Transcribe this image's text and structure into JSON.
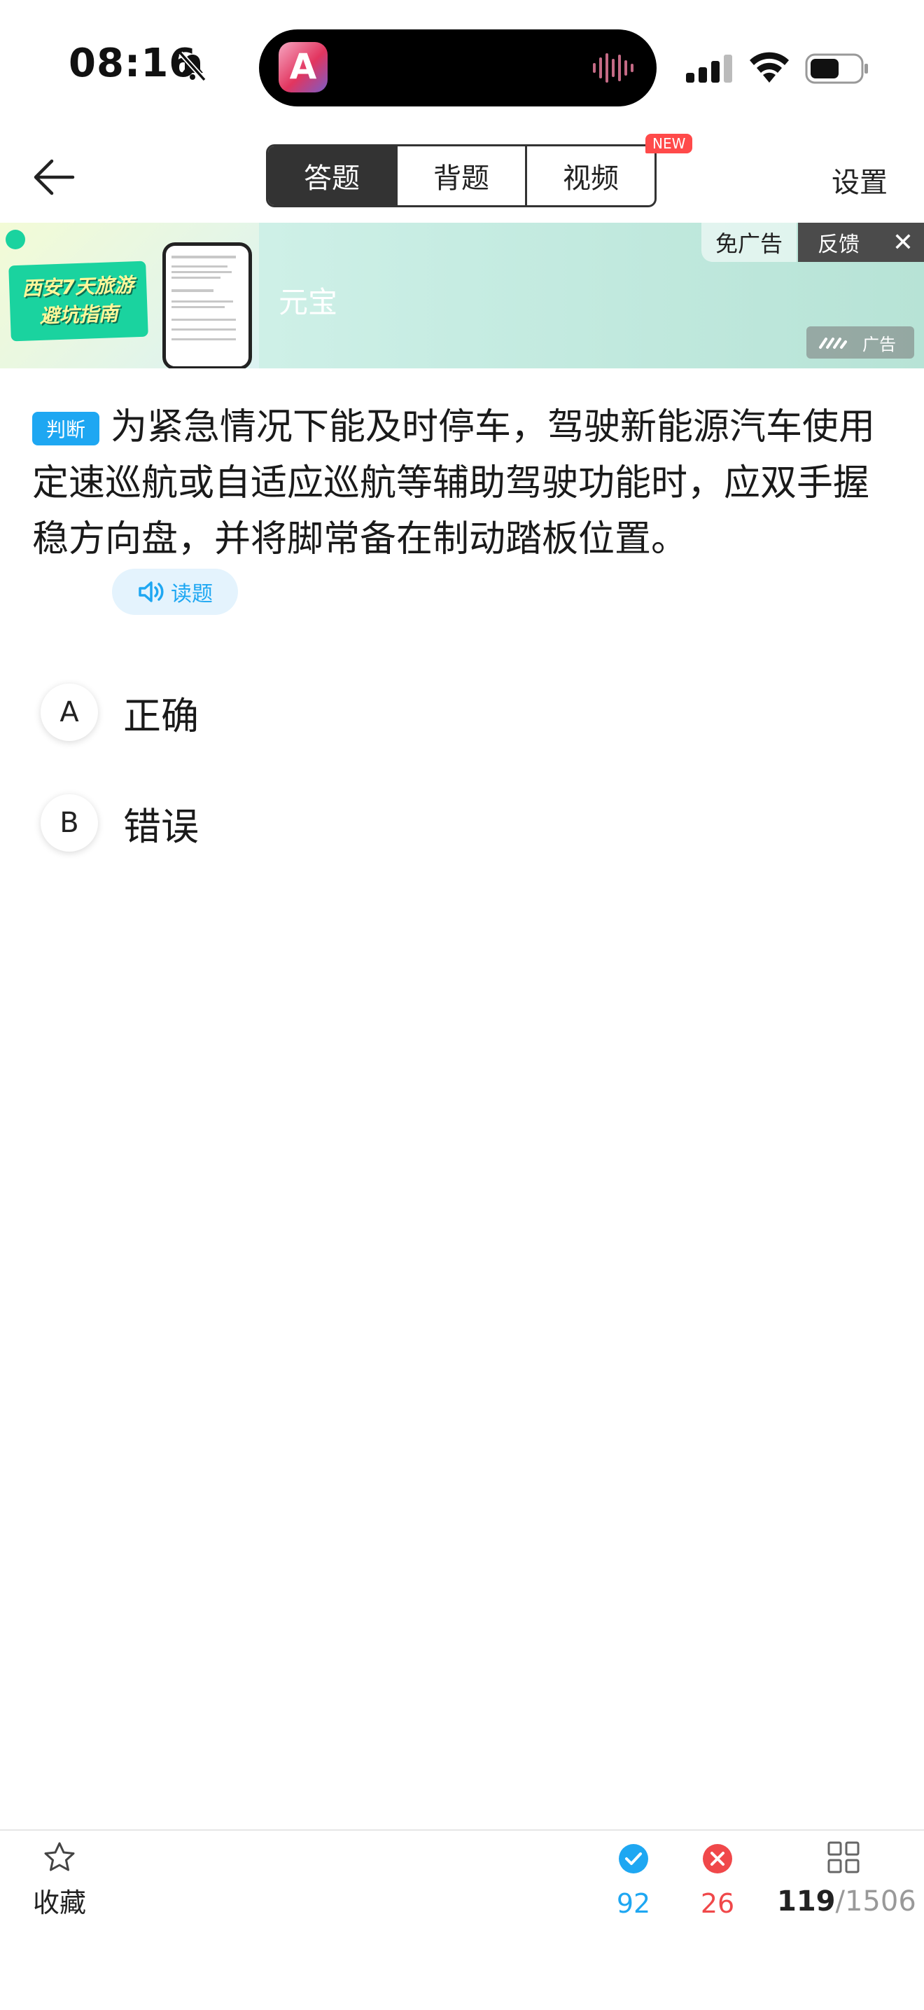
{
  "status_bar": {
    "time": "08:16"
  },
  "nav": {
    "tabs": [
      {
        "label": "答题",
        "active": true
      },
      {
        "label": "背题",
        "active": false
      },
      {
        "label": "视频",
        "active": false
      }
    ],
    "new_badge": "NEW",
    "settings_label": "设置"
  },
  "ad": {
    "thumb_text_line1": "西安7天旅游",
    "thumb_text_line2": "避坑指南",
    "title": "元宝",
    "no_ad_label": "免广告",
    "feedback_label": "反馈",
    "ad_label": "广告"
  },
  "question": {
    "type_badge": "判断",
    "text": "为紧急情况下能及时停车，驾驶新能源汽车使用定速巡航或自适应巡航等辅助驾驶功能时，应双手握稳方向盘，并将脚常备在制动踏板位置。",
    "read_label": "读题",
    "options": [
      {
        "letter": "A",
        "text": "正确"
      },
      {
        "letter": "B",
        "text": "错误"
      }
    ]
  },
  "bottom_bar": {
    "favorite_label": "收藏",
    "correct_count": "92",
    "wrong_count": "26",
    "current_index": "119",
    "total": "/1506"
  },
  "colors": {
    "accent_blue": "#1ea7f2",
    "wrong_red": "#f0484a",
    "new_badge": "#ff4a4a"
  }
}
